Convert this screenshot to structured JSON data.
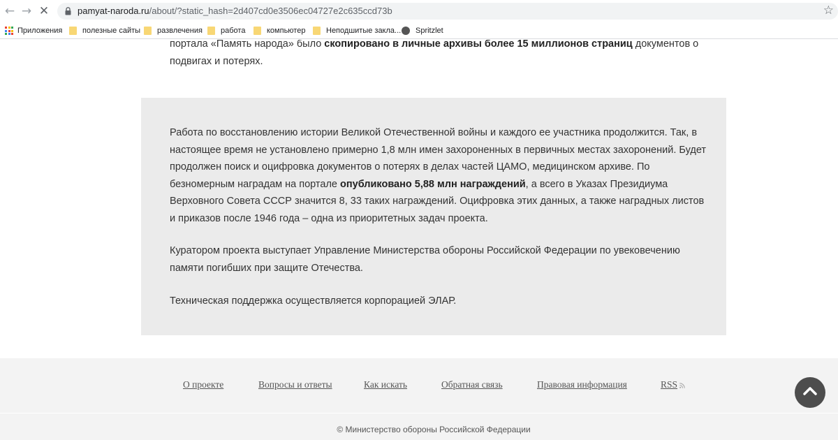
{
  "browser": {
    "url_host": "pamyat-naroda.ru",
    "url_path": "/about/?static_hash=2d407cd0e3506ec04727e2c635ccd73b",
    "bookmarks": {
      "apps": "Приложения",
      "useful": "полезные сайты",
      "fun": "развлечения",
      "work": "работа",
      "computer": "компьютер",
      "unsorted": "Неподшитые закла...",
      "spritzlet": "Spritzlet"
    }
  },
  "content": {
    "top_para": {
      "t1": "портала «Память народа» было ",
      "b1": "скопировано в личные архивы более 15 миллионов страниц",
      "t2": " документов о подвигах и потерях."
    },
    "box_para1": {
      "t1": "Работа по восстановлению истории Великой Отечественной войны и каждого ее участника продолжится. Так, в настоящее время не установлено примерно 1,8 млн имен захороненных в первичных местах захоронений. Будет продолжен поиск и оцифровка документов о потерях в делах частей ЦАМО, медицинском архиве. По безномерным наградам на портале ",
      "b1": "опубликовано 5,88 млн награждений",
      "t2": ", а всего в Указах Президиума Верховного Совета СССР значится 8, 33 таких награждений. Оцифровка этих данных, а также наградных листов и приказов после 1946 года – одна из приоритетных задач проекта."
    },
    "box_para2": "Куратором проекта выступает Управление Министерства обороны Российской Федерации по увековечению памяти погибших при защите Отечества.",
    "box_para3": "Техническая поддержка осуществляется корпорацией ЭЛАР."
  },
  "footer": {
    "links": {
      "about": "О проекте",
      "faq": "Вопросы и ответы",
      "how_to_search": "Как искать",
      "feedback": "Обратная связь",
      "legal": "Правовая информация",
      "rss": "RSS"
    },
    "copyright": "© Министерство обороны Российской Федерации"
  },
  "colors": {
    "box_bg": "#ebebeb",
    "footer_bg": "#f3f3f3",
    "scroll_button": "#4d4d4d"
  },
  "icons": [
    "back-arrow-icon",
    "forward-arrow-icon",
    "stop-loading-icon",
    "lock-icon",
    "bookmark-star-icon",
    "apps-grid-icon",
    "folder-icon",
    "spritzlet-globe-icon",
    "rss-icon",
    "chevron-up-icon"
  ]
}
